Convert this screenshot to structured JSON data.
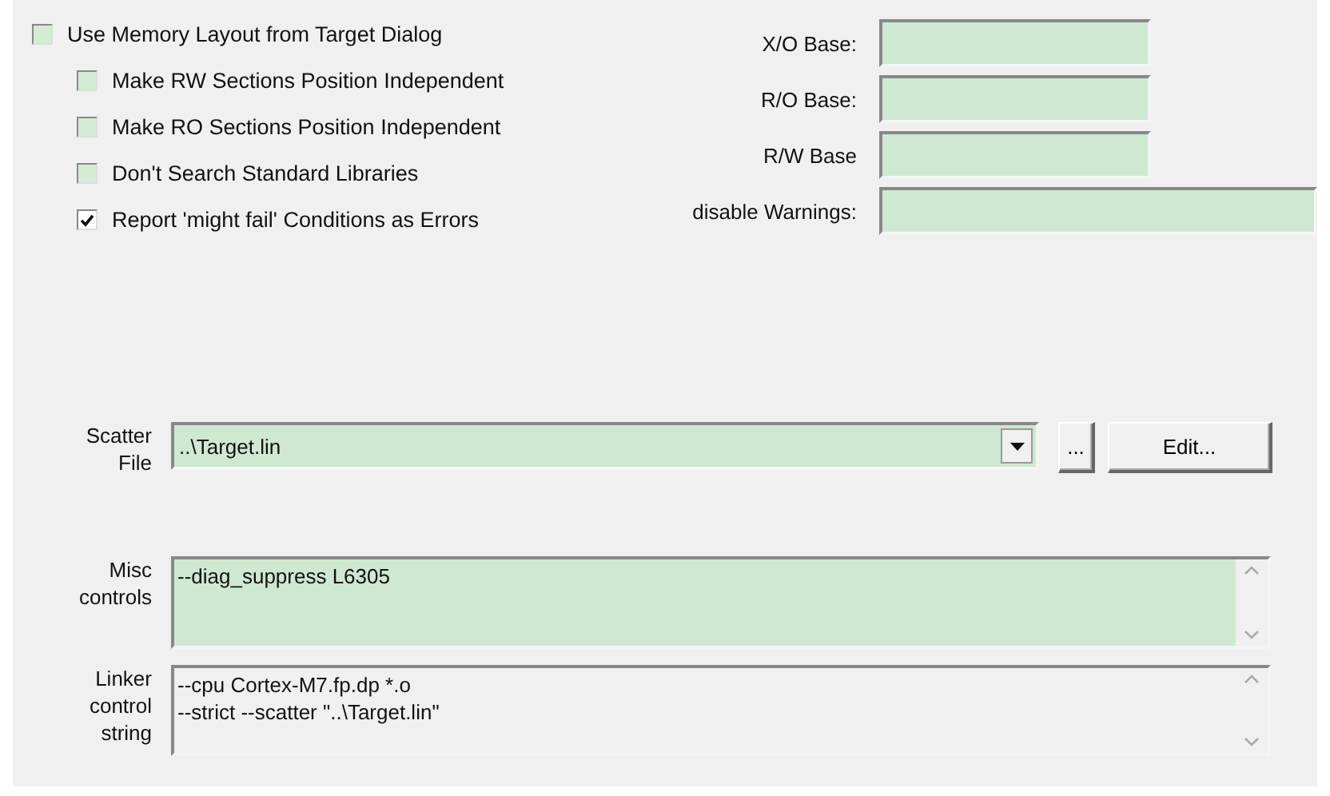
{
  "options": [
    {
      "label": "Use Memory Layout from Target Dialog",
      "checked": false,
      "indented": false
    },
    {
      "label": "Make RW Sections Position Independent",
      "checked": false,
      "indented": true
    },
    {
      "label": "Make RO Sections Position Independent",
      "checked": false,
      "indented": true
    },
    {
      "label": "Don't Search Standard Libraries",
      "checked": false,
      "indented": true
    },
    {
      "label": "Report 'might fail' Conditions as Errors",
      "checked": true,
      "indented": true
    }
  ],
  "bases": [
    {
      "label": "X/O Base:",
      "wide": false
    },
    {
      "label": "R/O Base:",
      "wide": false
    },
    {
      "label": "R/W Base",
      "wide": false
    },
    {
      "label": "disable Warnings:",
      "wide": true
    }
  ],
  "scatter": {
    "label_lines": [
      "Scatter",
      "File"
    ],
    "value": "..\\Target.lin",
    "browse": "...",
    "edit": "Edit..."
  },
  "misc": {
    "label_lines": [
      "Misc",
      "controls"
    ],
    "lines": [
      "--diag_suppress L6305"
    ]
  },
  "linker": {
    "label_lines": [
      "Linker",
      "control",
      "string"
    ],
    "lines": [
      "--cpu Cortex-M7.fp.dp *.o",
      "--strict --scatter \"..\\Target.lin\""
    ]
  }
}
